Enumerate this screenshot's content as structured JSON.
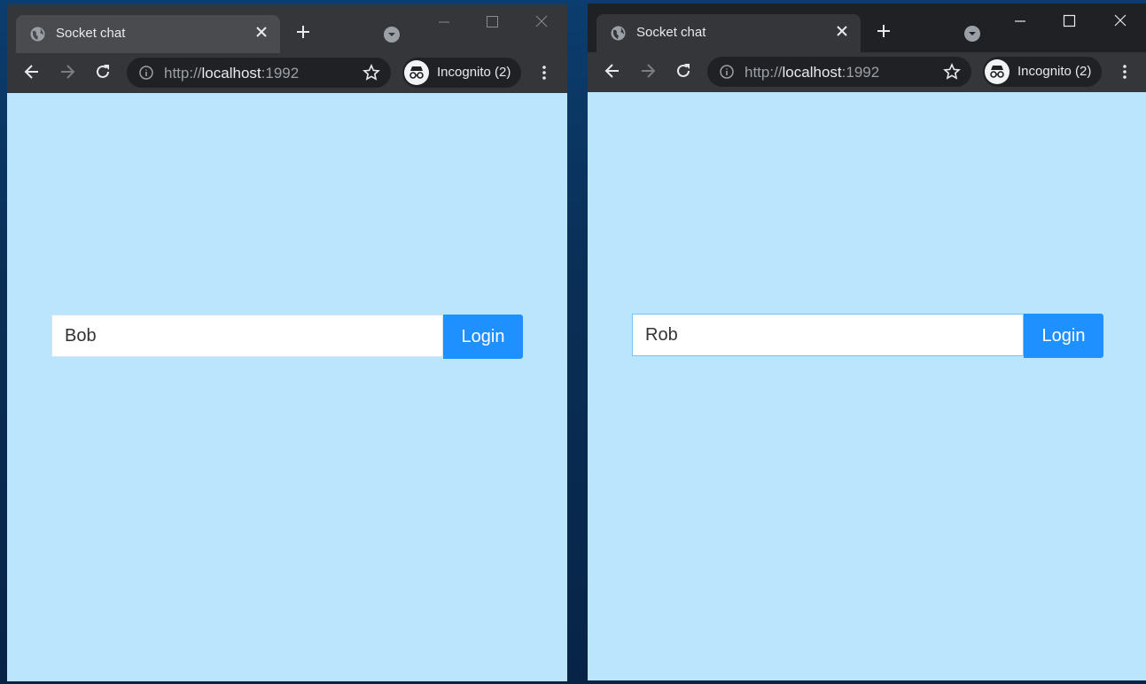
{
  "windows": [
    {
      "tab_title": "Socket chat",
      "url_scheme": "http://",
      "url_host": "localhost",
      "url_port": ":1992",
      "incognito_label": "Incognito (2)",
      "username_value": "Bob",
      "login_label": "Login"
    },
    {
      "tab_title": "Socket chat",
      "url_scheme": "http://",
      "url_host": "localhost",
      "url_port": ":1992",
      "incognito_label": "Incognito (2)",
      "username_value": "Rob",
      "login_label": "Login"
    }
  ],
  "icons": [
    "globe-icon",
    "close-icon",
    "plus-icon",
    "dropdown-icon",
    "minimize-icon",
    "maximize-icon",
    "window-close-icon",
    "back-icon",
    "forward-icon",
    "reload-icon",
    "info-icon",
    "star-icon",
    "incognito-icon",
    "more-icon"
  ],
  "colors": {
    "page_background": "#bbe5fd",
    "login_button": "#1e90ff",
    "chrome_dark": "#202124",
    "chrome_toolbar": "#35363a"
  }
}
